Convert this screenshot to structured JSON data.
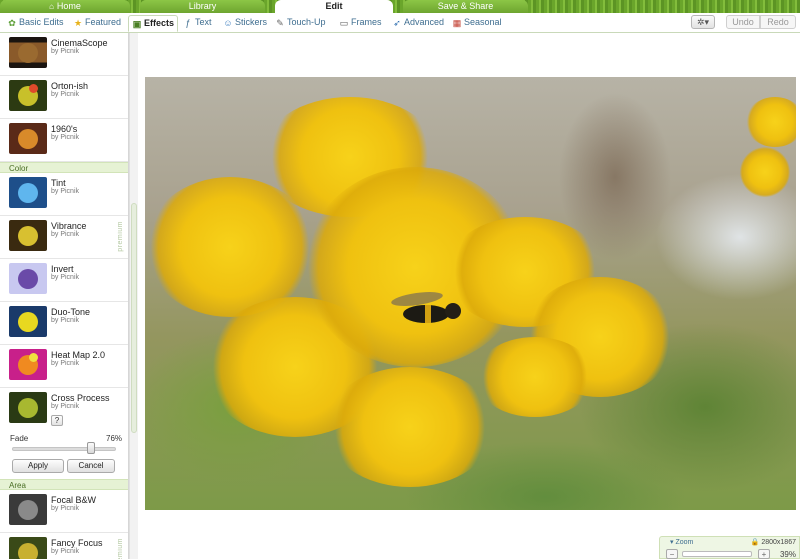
{
  "top_nav": {
    "tabs": [
      {
        "label": "Home"
      },
      {
        "label": "Library"
      },
      {
        "label": "Edit"
      },
      {
        "label": "Save & Share"
      }
    ]
  },
  "sub_nav": {
    "tabs": [
      {
        "label": "Basic Edits",
        "icon": "basic-edits-icon"
      },
      {
        "label": "Featured",
        "icon": "star-icon"
      },
      {
        "label": "Effects",
        "icon": "effects-icon"
      },
      {
        "label": "Text",
        "icon": "text-icon"
      },
      {
        "label": "Stickers",
        "icon": "stickers-icon"
      },
      {
        "label": "Touch-Up",
        "icon": "touch-up-icon"
      },
      {
        "label": "Frames",
        "icon": "frames-icon"
      },
      {
        "label": "Advanced",
        "icon": "advanced-icon"
      },
      {
        "label": "Seasonal",
        "icon": "calendar-icon"
      }
    ],
    "active": "Effects",
    "gear_label": "✲▾",
    "undo_label": "Undo",
    "redo_label": "Redo"
  },
  "panel": {
    "premium_label": "premium",
    "effects_top": [
      {
        "name": "CinemaScope",
        "by": "by Picnik"
      },
      {
        "name": "Orton-ish",
        "by": "by Picnik"
      },
      {
        "name": "1960's",
        "by": "by Picnik"
      }
    ],
    "color_section": "Color",
    "color_effects": [
      {
        "name": "Tint",
        "by": "by Picnik"
      },
      {
        "name": "Vibrance",
        "by": "by Picnik"
      },
      {
        "name": "Invert",
        "by": "by Picnik"
      },
      {
        "name": "Duo-Tone",
        "by": "by Picnik"
      },
      {
        "name": "Heat Map 2.0",
        "by": "by Picnik"
      },
      {
        "name": "Cross Process",
        "by": "by Picnik"
      }
    ],
    "help_label": "?",
    "fade_label": "Fade",
    "fade_value": "76%",
    "fade_fraction": 0.76,
    "apply_label": "Apply",
    "cancel_label": "Cancel",
    "area_section": "Area",
    "area_effects": [
      {
        "name": "Focal B&W",
        "by": "by Picnik"
      },
      {
        "name": "Fancy Focus",
        "by": "by Picnik"
      }
    ]
  },
  "zoom": {
    "label": "Zoom",
    "dimensions": "2800x1867",
    "percent": "39%"
  },
  "colors": {
    "accent_green": "#6aa52b",
    "link_blue": "#3f6e90",
    "section_bg": "#e6f2d4"
  }
}
